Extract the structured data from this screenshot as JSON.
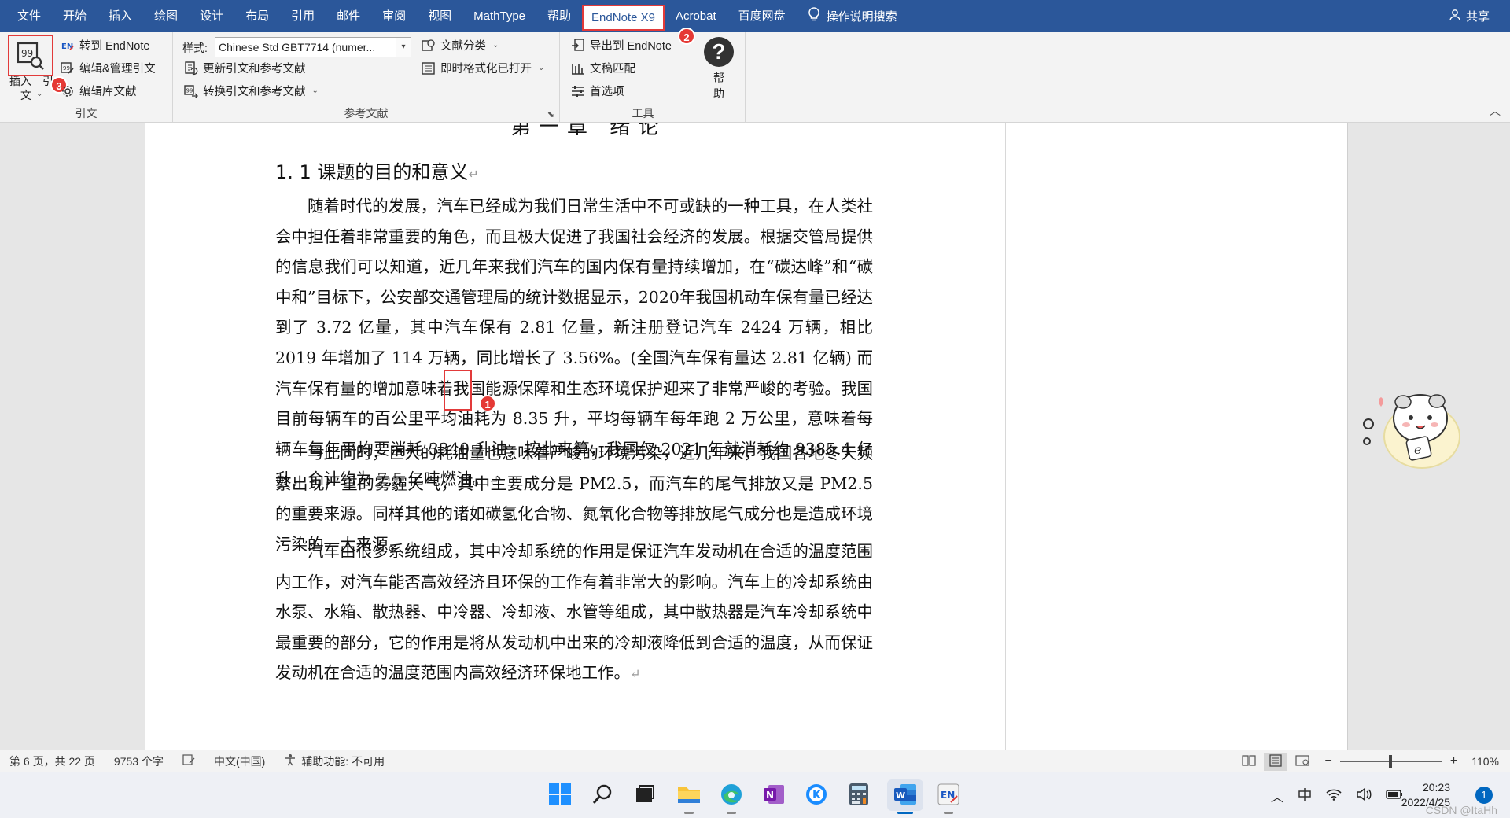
{
  "menu": {
    "items": [
      "文件",
      "开始",
      "插入",
      "绘图",
      "设计",
      "布局",
      "引用",
      "邮件",
      "审阅",
      "视图",
      "MathType",
      "帮助",
      "EndNote X9",
      "Acrobat",
      "百度网盘"
    ],
    "search_label": "操作说明搜索",
    "share_label": "共享"
  },
  "ribbon": {
    "citation_group": {
      "insert_label_1": "插入",
      "insert_label_2": "引",
      "insert_label_3": "文",
      "goto_endnote": "转到 EndNote",
      "edit_manage": "编辑&管理引文",
      "edit_library": "编辑库文献",
      "label": "引文"
    },
    "bibliography_group": {
      "style_label": "样式:",
      "style_value": "Chinese Std GBT7714 (numer...",
      "update": "更新引文和参考文献",
      "convert": "转换引文和参考文献",
      "categorize": "文献分类",
      "instant_format": "即时格式化已打开",
      "label": "参考文献"
    },
    "tools_group": {
      "export": "导出到 EndNote",
      "manuscript": "文稿匹配",
      "preferences": "首选项",
      "help_1": "帮",
      "help_2": "助",
      "label": "工具"
    },
    "badges": {
      "step1": "1",
      "step2": "2",
      "step3": "3"
    }
  },
  "document": {
    "partial_title": "第一章 绪论",
    "heading": "1. 1 课题的目的和意义",
    "paragraphs": [
      "随着时代的发展，汽车已经成为我们日常生活中不可或缺的一种工具，在人类社会中担任着非常重要的角色，而且极大促进了我国社会经济的发展。根据交管局提供的信息我们可以知道，近几年来我们汽车的国内保有量持续增加，在“碳达峰”和“碳中和”目标下，公安部交通管理局的统计数据显示，2020年我国机动车保有量已经达到了 3.72 亿量，其中汽车保有 2.81 亿量，新注册登记汽车 2424 万辆，相比 2019 年增加了 114 万辆，同比增长了 3.56%。(全国汽车保有量达 2.81 亿辆) 而汽车保有量的增加意味着我国能源保障和生态环境保护迎来了非常严峻的考验。我国目前每辆车的百公里平均油耗为 8.35 升，平均每辆车每年跑 2 万公里，意味着每辆车每年平均要消耗 3340 升油，按此来算，我国仅 2021 年就消耗约 9385.4 亿升，合计约为 7.5 亿吨燃油。",
      "与此同时，巨大的耗油量也意味着严峻的环境污染，近几年来，我国各地冬天频繁出现严重的雾霾天气，其中主要成分是 PM2.5，而汽车的尾气排放又是 PM2.5 的重要来源。同样其他的诸如碳氢化合物、氮氧化合物等排放尾气成分也是造成环境污染的一大来源。",
      "汽车由很多系统组成，其中冷却系统的作用是保证汽车发动机在合适的温度范围内工作，对汽车能否高效经济且环保的工作有着非常大的影响。汽车上的冷却系统由水泵、水箱、散热器、中冷器、冷却液、水管等组成，其中散热器是汽车冷却系统中最重要的部分，它的作用是将从发动机中出来的冷却液降低到合适的温度，从而保证发动机在合适的温度范围内高效经济环保地工作。"
    ]
  },
  "status": {
    "page": "第 6 页，共 22 页",
    "words": "9753 个字",
    "lang": "中文(中国)",
    "accessibility": "辅助功能: 不可用",
    "zoom": "110%",
    "zoom_minus": "−",
    "zoom_plus": "+"
  },
  "taskbar": {
    "apps": [
      "windows-start",
      "search",
      "task-view",
      "file-explorer",
      "edge",
      "onenote",
      "k-app",
      "calculator",
      "word",
      "endnote"
    ],
    "time": "20:23",
    "date": "2022/4/25",
    "notifications": "1",
    "watermark": "CSDN @ItaHh"
  },
  "colors": {
    "word_blue": "#2b579a",
    "highlight_red": "#e23a3a",
    "taskbar_bg": "#eef0f5"
  }
}
